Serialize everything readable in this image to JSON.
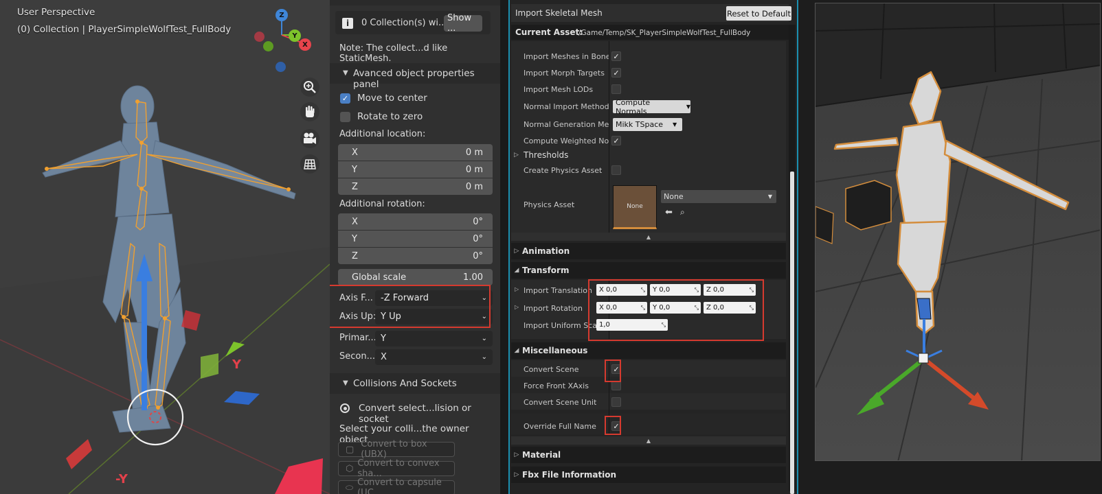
{
  "blender_viewport": {
    "view_name": "User Perspective",
    "collection_line": "(0) Collection | PlayerSimpleWolfTest_FullBody",
    "gizmo": {
      "z": "Z",
      "y": "Y",
      "x": "X"
    },
    "axis_labels": {
      "y": "Y",
      "neg_y": "-Y"
    },
    "nav_icons": [
      "zoom-icon",
      "hand-pan-icon",
      "camera-icon",
      "grid-icon"
    ]
  },
  "blender_sidebar": {
    "info_text": "0 Collection(s) wi...",
    "show_button": "Show ...",
    "note": "Note: The collect...d like StaticMesh.",
    "adv_panel": "Avanced object properties panel",
    "move_to_center": {
      "label": "Move to center",
      "checked": true
    },
    "rotate_to_zero": {
      "label": "Rotate to zero",
      "checked": false
    },
    "add_location_label": "Additional location:",
    "location": [
      {
        "axis": "X",
        "value": "0 m"
      },
      {
        "axis": "Y",
        "value": "0 m"
      },
      {
        "axis": "Z",
        "value": "0 m"
      }
    ],
    "add_rotation_label": "Additional rotation:",
    "rotation": [
      {
        "axis": "X",
        "value": "0°"
      },
      {
        "axis": "Y",
        "value": "0°"
      },
      {
        "axis": "Z",
        "value": "0°"
      }
    ],
    "global_scale": {
      "label": "Global scale",
      "value": "1.00"
    },
    "axis_forward": {
      "label": "Axis F...",
      "value": "-Z Forward"
    },
    "axis_up": {
      "label": "Axis Up:",
      "value": "Y Up"
    },
    "primary": {
      "label": "Primar...",
      "value": "Y"
    },
    "secondary": {
      "label": "Secon...",
      "value": "X"
    },
    "collisions_panel": "Collisions And Sockets",
    "convert_select": "Convert select...lision or socket",
    "select_colli": "Select your colli...the owner object.",
    "convert_box": "Convert to box (UBX)",
    "convert_convex": "Convert to convex sha...",
    "convert_capsule": "Convert to capsule (UC..."
  },
  "unreal_dialog": {
    "title": "Import Skeletal Mesh",
    "reset_button": "Reset to Default",
    "current_asset_label": "Current Asset:",
    "current_asset_path": "/Game/Temp/SK_PlayerSimpleWolfTest_FullBody",
    "rows": {
      "import_meshes_bone": "Import Meshes in Bone H",
      "import_morph": "Import Morph Targets",
      "import_lods": "Import Mesh LODs",
      "normal_import_method": "Normal Import Method",
      "normal_import_value": "Compute Normals",
      "normal_gen_method": "Normal Generation Meth",
      "normal_gen_value": "Mikk TSpace",
      "compute_weighted": "Compute Weighted Norm",
      "thresholds": "Thresholds",
      "create_physics": "Create Physics Asset",
      "physics_asset": "Physics Asset",
      "physics_thumb": "None",
      "physics_combo": "None"
    },
    "categories": {
      "animation": "Animation",
      "transform": "Transform",
      "misc": "Miscellaneous",
      "material": "Material",
      "fbx_info": "Fbx File Information"
    },
    "transform": {
      "import_translation": "Import Translation",
      "import_rotation": "Import Rotation",
      "import_uniform_scale": "Import Uniform Scale",
      "translation": [
        {
          "axis": "X",
          "value": "0,0"
        },
        {
          "axis": "Y",
          "value": "0,0"
        },
        {
          "axis": "Z",
          "value": "0,0"
        }
      ],
      "rotation": [
        {
          "axis": "X",
          "value": "0,0"
        },
        {
          "axis": "Y",
          "value": "0,0"
        },
        {
          "axis": "Z",
          "value": "0,0"
        }
      ],
      "uniform_scale": "1,0"
    },
    "misc": {
      "convert_scene": {
        "label": "Convert Scene",
        "checked": true
      },
      "force_front_xaxis": {
        "label": "Force Front XAxis",
        "checked": false
      },
      "convert_scene_unit": {
        "label": "Convert Scene Unit",
        "checked": false
      },
      "override_full_name": {
        "label": "Override Full Name",
        "checked": true
      }
    }
  },
  "colors": {
    "highlight": "#d63a2f",
    "bone_orange": "#f0a030",
    "check_blue": "#4a7fc4",
    "gizmo_x": "#e8444c",
    "gizmo_y": "#7dc32b",
    "gizmo_z": "#3f86d8"
  }
}
